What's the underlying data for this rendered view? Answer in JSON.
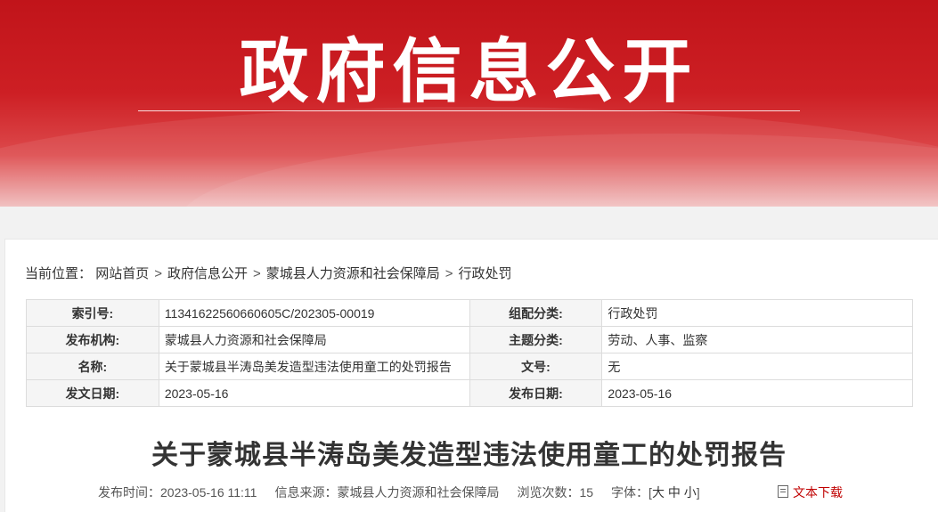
{
  "banner": {
    "title": "政府信息公开"
  },
  "breadcrumb": {
    "label": "当前位置：",
    "items": [
      "网站首页",
      "政府信息公开",
      "蒙城县人力资源和社会保障局",
      "行政处罚"
    ],
    "separator": ">"
  },
  "info_table": {
    "rows": [
      {
        "k1": "索引号:",
        "v1": "11341622560660605C/202305-00019",
        "k2": "组配分类:",
        "v2": "行政处罚"
      },
      {
        "k1": "发布机构:",
        "v1": "蒙城县人力资源和社会保障局",
        "k2": "主题分类:",
        "v2": "劳动、人事、监察"
      },
      {
        "k1": "名称:",
        "v1": "关于蒙城县半涛岛美发造型违法使用童工的处罚报告",
        "k2": "文号:",
        "v2": "无"
      },
      {
        "k1": "发文日期:",
        "v1": "2023-05-16",
        "k2": "发布日期:",
        "v2": "2023-05-16"
      }
    ]
  },
  "article": {
    "title": "关于蒙城县半涛岛美发造型违法使用童工的处罚报告",
    "publish_label": "发布时间：",
    "publish_time": "2023-05-16 11:11",
    "source_label": "信息来源：",
    "source": "蒙城县人力资源和社会保障局",
    "views_label": "浏览次数：",
    "views": "15",
    "font_label": "字体：",
    "font_open": "[",
    "font_large": "大",
    "font_medium": "中",
    "font_small": "小",
    "font_close": "]",
    "download_label": "文本下载"
  },
  "colors": {
    "banner_red": "#c1141a",
    "download_red": "#c00000"
  }
}
